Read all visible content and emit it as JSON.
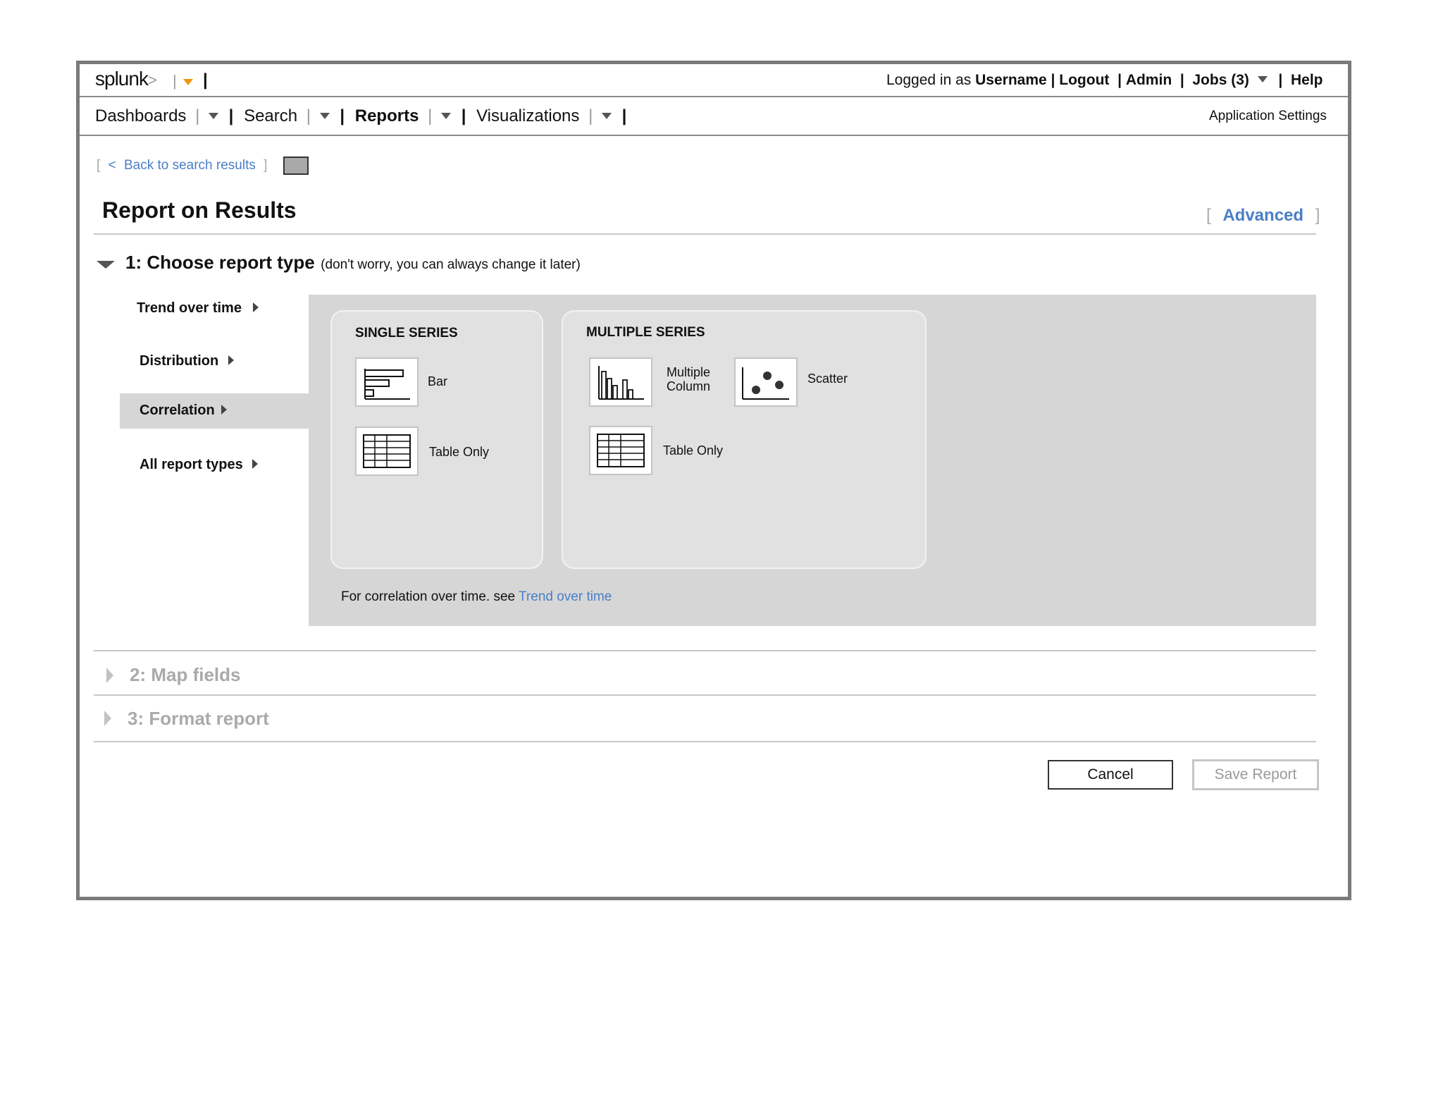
{
  "header": {
    "logo": "splunk",
    "logo_suffix": ">",
    "logged_in_prefix": "Logged in as",
    "username": "Username",
    "logout": "Logout",
    "admin": "Admin",
    "jobs": "Jobs (3)",
    "help": "Help"
  },
  "nav": {
    "items": [
      {
        "label": "Dashboards"
      },
      {
        "label": "Search"
      },
      {
        "label": "Reports"
      },
      {
        "label": "Visualizations"
      }
    ],
    "app_settings": "Application Settings"
  },
  "back": {
    "open_bracket": "[",
    "arrow": "<",
    "label": "Back to search results",
    "close_bracket": "]"
  },
  "page": {
    "title": "Report on Results",
    "advanced": "Advanced",
    "adv_open": "[",
    "adv_close": "]"
  },
  "step1": {
    "title": "1: Choose report type",
    "subtitle": "(don't worry, you can always change it later)",
    "categories": [
      {
        "label": "Trend over time"
      },
      {
        "label": "Distribution"
      },
      {
        "label": "Correlation"
      },
      {
        "label": "All report types"
      }
    ],
    "single_series": {
      "heading": "SINGLE SERIES",
      "options": [
        {
          "label": "Bar",
          "icon": "bar-chart-icon"
        },
        {
          "label": "Table Only",
          "icon": "table-icon"
        }
      ]
    },
    "multiple_series": {
      "heading": "MULTIPLE SERIES",
      "options": [
        {
          "label_line1": "Multiple",
          "label_line2": "Column",
          "icon": "column-chart-icon"
        },
        {
          "label": "Scatter",
          "icon": "scatter-chart-icon"
        },
        {
          "label": "Table Only",
          "icon": "table-icon"
        }
      ]
    },
    "note_prefix": "For correlation over time. see",
    "note_link": "Trend over time"
  },
  "step2": {
    "title": "2: Map fields"
  },
  "step3": {
    "title": "3: Format report"
  },
  "actions": {
    "cancel": "Cancel",
    "save": "Save Report"
  },
  "colors": {
    "accent": "#f0960e",
    "link": "#4a7ec7",
    "panel": "#d6d6d6",
    "selected_category": "#d6d6d6"
  }
}
